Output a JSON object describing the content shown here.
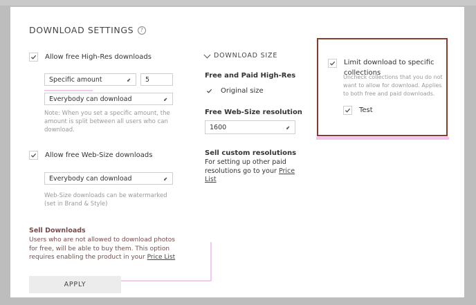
{
  "modal": {
    "title": "DOWNLOAD SETTINGS",
    "apply_label": "APPLY"
  },
  "left": {
    "highres": {
      "checkbox_label": "Allow free High-Res downloads",
      "amount_select": "Specific amount",
      "amount_value": "5",
      "audience_select": "Everybody can download",
      "note": "Note: When you set a specific amount, the amount is split between all users who can download."
    },
    "websize": {
      "checkbox_label": "Allow free Web-Size downloads",
      "audience_select": "Everybody can download",
      "note": "Web-Size downloads can be watermarked (set in Brand & Style)"
    },
    "sell": {
      "title": "Sell Downloads",
      "text": "Users who are not allowed to download photos for free, will be able to buy them. This option requires enabling the product in your",
      "link": "Price List"
    }
  },
  "middle": {
    "heading": "DOWNLOAD SIZE",
    "free_paid_title": "Free and Paid High-Res",
    "original_label": "Original size",
    "websize_title": "Free Web-Size resolution",
    "websize_value": "1600",
    "custom_title": "Sell custom resolutions",
    "custom_text": "For setting up other paid resolutions go to your",
    "custom_link": "Price List"
  },
  "right": {
    "limit_label": "Limit download to specific collections",
    "limit_note": "Uncheck collections that you do not want to allow for download. Applies to both free and paid downloads.",
    "collection_label": "Test"
  },
  "colors": {
    "highlight": "#8a3a2a",
    "accent_pink": "#f3c2f0"
  }
}
